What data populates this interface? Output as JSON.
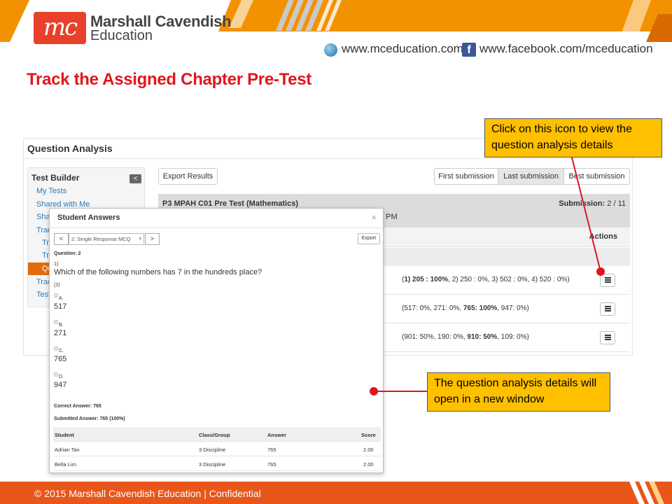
{
  "header": {
    "logo_mark": "mc",
    "logo_line1": "Marshall Cavendish",
    "logo_line2": "Education",
    "website": "www.mceducation.com",
    "facebook": "www.facebook.com/mceducation",
    "facebook_glyph": "f"
  },
  "slide_title": "Track the Assigned Chapter Pre-Test",
  "panel": {
    "title": "Question Analysis",
    "sidebar": {
      "title": "Test Builder",
      "collapse_glyph": "<",
      "items": [
        "My Tests",
        "Shared with Me",
        "Sha",
        "Trac",
        "Tra",
        "Tra",
        "Qu",
        "Trac",
        "Test"
      ]
    },
    "export_label": "Export Results",
    "submission_tabs": [
      "First submission",
      "Last submission",
      "Best submission"
    ],
    "active_tab": "Last submission",
    "test_name": "P3 MPAH C01 Pre Test (Mathematics)",
    "submission_label": "Submission:",
    "submission_value": "2 / 11",
    "date_fragment": "5 PM",
    "actions_header": "Actions",
    "rows": [
      {
        "pre": "(",
        "bold": "1) 205 : 100%",
        "post": ", 2) 250 : 0%, 3) 502 : 0%, 4) 520 : 0%)"
      },
      {
        "pre": "(517: 0%, 271: 0%, ",
        "bold": "765: 100%",
        "post": ", 947: 0%)"
      },
      {
        "pre": "(901: 50%, 190: 0%, ",
        "bold": "910: 50%",
        "post": ", 109: 0%)"
      }
    ]
  },
  "modal": {
    "title": "Student Answers",
    "close": "×",
    "prev": "<",
    "next": ">",
    "question_select": "2: Single Response MCQ",
    "export_label": "Export",
    "question_label": "Question: 2",
    "part1_label": "1)",
    "question_text": "Which of the following numbers has 7 in the hundreds place?",
    "part2_label": "(2)",
    "options": [
      {
        "letter": "A.",
        "value": "517"
      },
      {
        "letter": "B.",
        "value": "271"
      },
      {
        "letter": "C.",
        "value": "765"
      },
      {
        "letter": "D.",
        "value": "947"
      }
    ],
    "correct_answer": "Correct Answer: 765",
    "submitted_answer": "Submitted Answer: 765 (100%)",
    "table": {
      "headers": [
        "Student",
        "Class/Group",
        "Answer",
        "Score"
      ],
      "rows": [
        [
          "Adrian Tan",
          "3 Discipline",
          "765",
          "2.00"
        ],
        [
          "Bella Lim",
          "3 Discipline",
          "765",
          "2.00"
        ]
      ]
    }
  },
  "callouts": {
    "icon_tip": "Click on this icon to view the question analysis details",
    "window_tip": "The question analysis details will open in a new window"
  },
  "footer": "© 2015 Marshall Cavendish Education | Confidential",
  "colors": {
    "brand_orange": "#f39200",
    "title_red": "#e0161e",
    "callout_yellow": "#ffc000",
    "footer_orange": "#e8561a",
    "sidebar_active": "#e36c0a"
  }
}
